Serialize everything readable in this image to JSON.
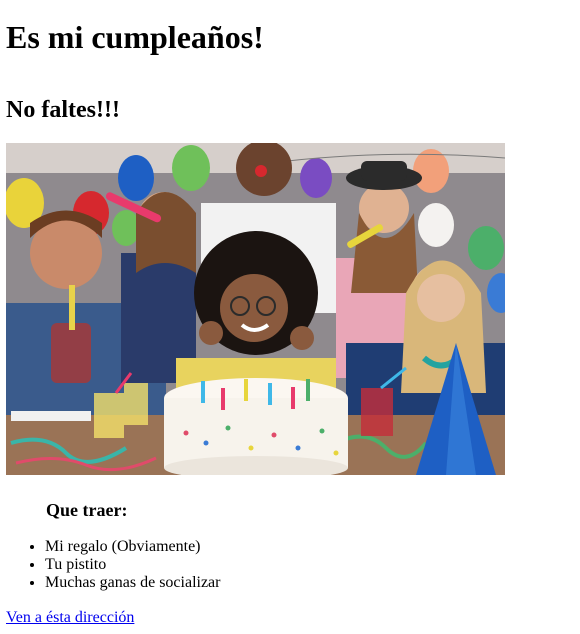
{
  "heading": {
    "title": "Es mi cumpleaños!",
    "subtitle": "No faltes!!!"
  },
  "photo": {
    "alt": "party-photo",
    "colors": {
      "wall": "#c9c2bf",
      "table": "#9a7356",
      "cake": "#f7f3ec",
      "accent_red": "#d6282e",
      "accent_blue": "#1e5fc4",
      "accent_yellow": "#e7d53c",
      "accent_green": "#4caf6a"
    }
  },
  "bring": {
    "title": "Que traer:",
    "items": [
      "Mi regalo (Obviamente)",
      "Tu pistito",
      "Muchas ganas de socializar"
    ]
  },
  "link": {
    "label": "Ven a ésta dirección"
  }
}
